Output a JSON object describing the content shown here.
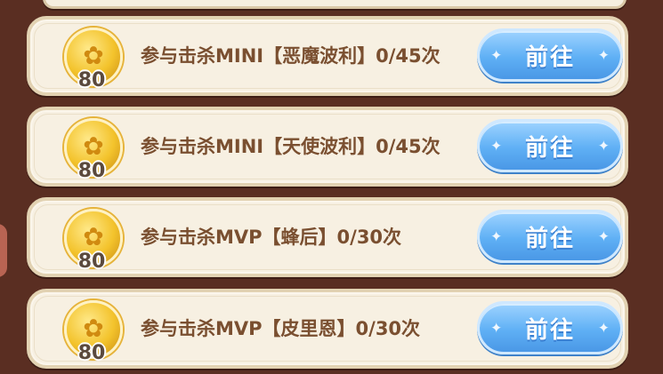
{
  "tasks": [
    {
      "text": "参与击杀MINI【恶魔波利】0/45次",
      "reward": "80",
      "button": "前往"
    },
    {
      "text": "参与击杀MINI【天使波利】0/45次",
      "reward": "80",
      "button": "前往"
    },
    {
      "text": "参与击杀MVP【蜂后】0/30次",
      "reward": "80",
      "button": "前往"
    },
    {
      "text": "参与击杀MVP【皮里恩】0/30次",
      "reward": "80",
      "button": "前往"
    }
  ],
  "icons": {
    "coin": "gold-coin-icon",
    "sparkle": "sparkle-icon"
  },
  "colors": {
    "background": "#5a2e22",
    "card": "#f7f0e2",
    "text": "#7a4f30",
    "button": "#5fb0f5"
  }
}
